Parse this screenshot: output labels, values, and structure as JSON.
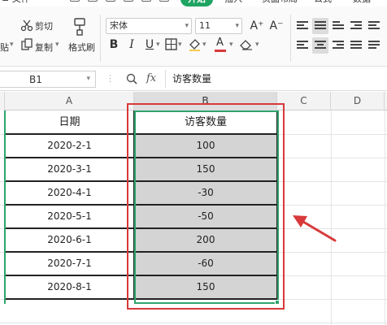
{
  "menu": {
    "file": "文件",
    "start": "开始",
    "insert": "插入",
    "layout": "页面布局",
    "formula": "公式",
    "data": "数据"
  },
  "ribbon": {
    "paste": "贴",
    "cut": "剪切",
    "copy": "复制",
    "format_painter": "格式刷",
    "font_name": "宋体",
    "font_size": "11",
    "grow_font": "A⁺",
    "shrink_font": "A⁻",
    "bold": "B",
    "italic": "I",
    "underline": "U",
    "font_color_letter": "A"
  },
  "formula_bar": {
    "name_box": "B1",
    "fx": "fx",
    "content": "访客数量"
  },
  "columns": [
    "A",
    "B",
    "C",
    "D"
  ],
  "table": {
    "headers": [
      "日期",
      "访客数量"
    ],
    "rows": [
      [
        "2020-2-1",
        "100"
      ],
      [
        "2020-3-1",
        "150"
      ],
      [
        "2020-4-1",
        "-30"
      ],
      [
        "2020-5-1",
        "-50"
      ],
      [
        "2020-6-1",
        "200"
      ],
      [
        "2020-7-1",
        "-60"
      ],
      [
        "2020-8-1",
        "150"
      ]
    ]
  },
  "colors": {
    "start_tab": "#1fa462",
    "selection": "#2fa46d",
    "annotation": "#d8393a",
    "selected_fill": "#d4d4d4"
  },
  "icons": [
    "scissors-icon",
    "copy-icon",
    "format-painter-icon",
    "zoom-icon",
    "border-icon",
    "fill-color-icon",
    "clear-icon",
    "align-icon",
    "arrow-annotation"
  ]
}
